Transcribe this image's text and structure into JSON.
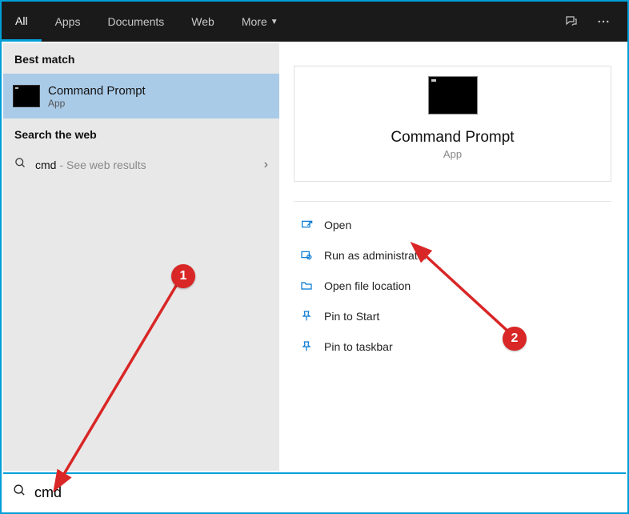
{
  "topbar": {
    "tabs": {
      "all": "All",
      "apps": "Apps",
      "documents": "Documents",
      "web": "Web",
      "more": "More"
    }
  },
  "left": {
    "best_match_label": "Best match",
    "best_item": {
      "title": "Command Prompt",
      "subtitle": "App"
    },
    "search_web_label": "Search the web",
    "web_item": {
      "term": "cmd",
      "hint": "- See web results"
    }
  },
  "preview": {
    "title": "Command Prompt",
    "subtitle": "App",
    "actions": {
      "open": "Open",
      "run_admin": "Run as administrator",
      "open_loc": "Open file location",
      "pin_start": "Pin to Start",
      "pin_taskbar": "Pin to taskbar"
    }
  },
  "search": {
    "value": "cmd"
  },
  "annotations": {
    "step1": "1",
    "step2": "2"
  }
}
